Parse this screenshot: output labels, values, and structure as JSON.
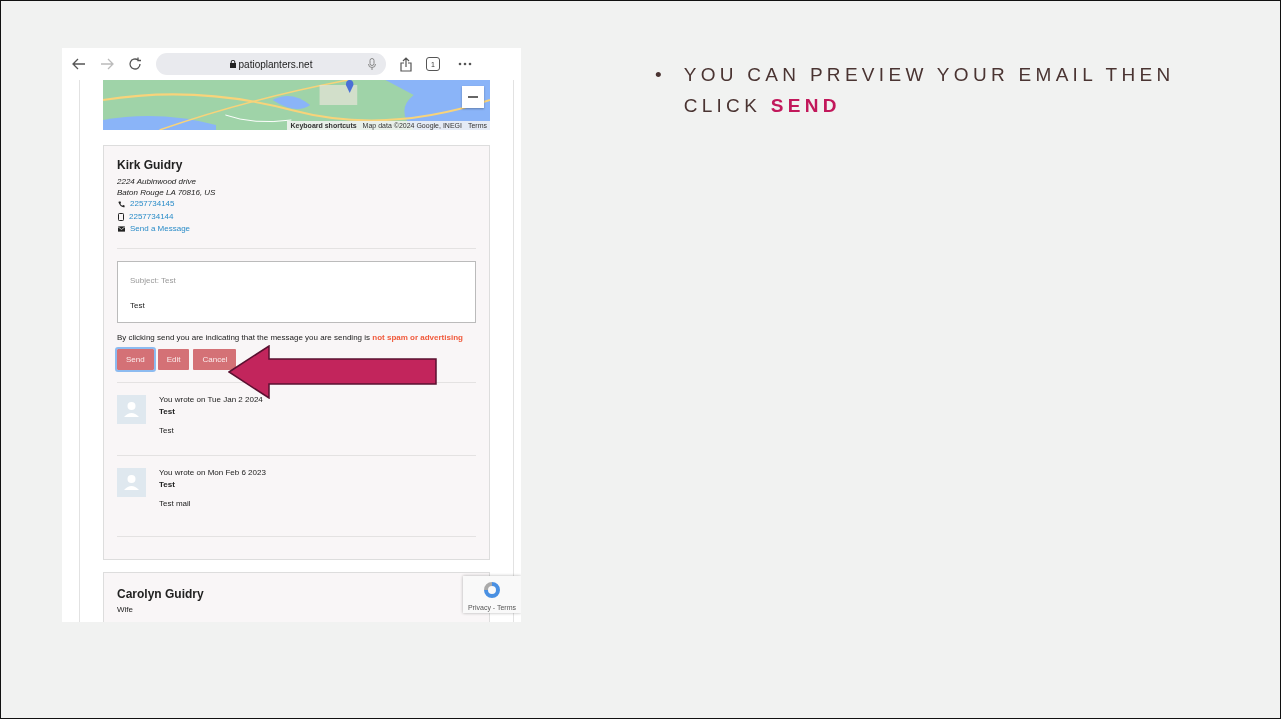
{
  "browser": {
    "url": "patioplanters.net",
    "tab_count": "1"
  },
  "map": {
    "kind": "picture",
    "attribution": [
      "Keyboard shortcuts",
      "Map data ©2024 Google, INEGI",
      "Terms"
    ]
  },
  "contact": {
    "name": "Kirk Guidry",
    "address": [
      "2224 Aubinwood drive",
      "Baton Rouge LA 70816, US"
    ],
    "links": [
      {
        "kind": "phone",
        "text": "2257734145"
      },
      {
        "kind": "mobile",
        "text": "2257734144"
      },
      {
        "kind": "email",
        "text": "Send a Message"
      }
    ]
  },
  "preview": {
    "subject": "Subject: Test",
    "body": "Test"
  },
  "consent": {
    "text": "By clicking send you are indicating that the message you are sending is",
    "emphasis": "not spam or advertising"
  },
  "buttons": [
    {
      "label": "Send",
      "focused": true
    },
    {
      "label": "Edit",
      "focused": false
    },
    {
      "label": "Cancel",
      "focused": false
    }
  ],
  "messages": [
    {
      "meta": "You wrote on Tue Jan 2 2024",
      "subject": "Test",
      "body": "Test"
    },
    {
      "meta": "You wrote on Mon Feb 6 2023",
      "subject": "Test",
      "body": "Test mail"
    }
  ],
  "next_contact": {
    "name": "Carolyn Guidry",
    "relation": "Wife"
  },
  "recaptcha": {
    "text": "Privacy - Terms"
  },
  "bullets": [
    {
      "marker": "•",
      "text": "YOU CAN PREVIEW YOUR EMAIL THEN CLICK",
      "highlight": "SEND"
    }
  ]
}
